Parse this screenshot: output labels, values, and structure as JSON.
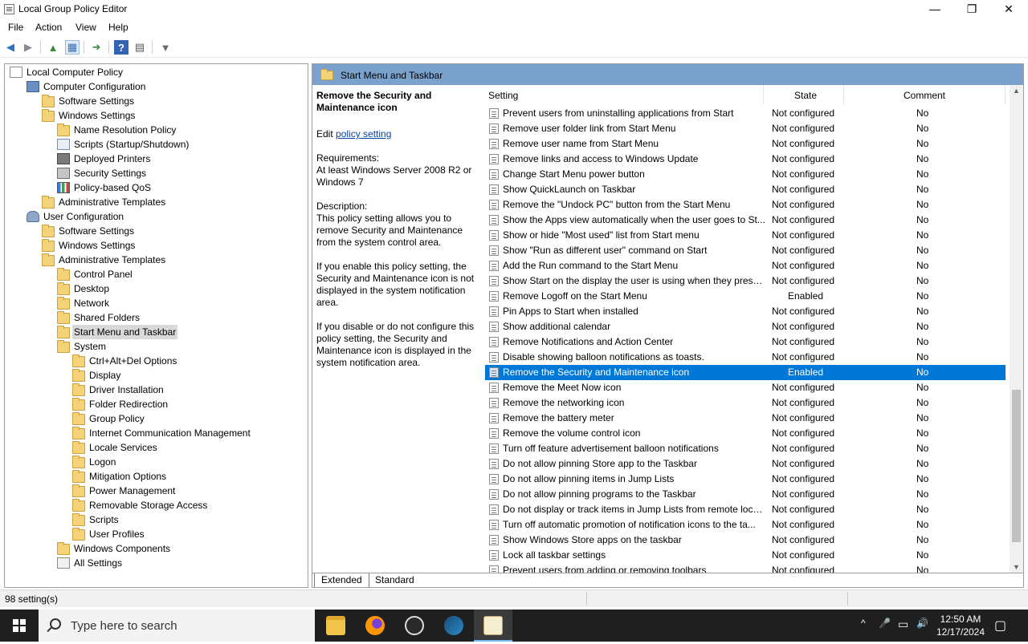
{
  "window": {
    "title": "Local Group Policy Editor",
    "minimize": "—",
    "maximize": "❐",
    "close": "✕"
  },
  "menu": [
    "File",
    "Action",
    "View",
    "Help"
  ],
  "tree": [
    {
      "label": "Local Computer Policy",
      "icon": "policy",
      "exp": ""
    },
    {
      "label": "Computer Configuration",
      "icon": "computer",
      "exp": "v"
    },
    {
      "label": "Software Settings",
      "icon": "folder",
      "exp": ">"
    },
    {
      "label": "Windows Settings",
      "icon": "folder",
      "exp": "v"
    },
    {
      "label": "Name Resolution Policy",
      "icon": "folder",
      "exp": ">"
    },
    {
      "label": "Scripts (Startup/Shutdown)",
      "icon": "script",
      "exp": ""
    },
    {
      "label": "Deployed Printers",
      "icon": "printer",
      "exp": ">"
    },
    {
      "label": "Security Settings",
      "icon": "security",
      "exp": ">"
    },
    {
      "label": "Policy-based QoS",
      "icon": "qos",
      "exp": ">"
    },
    {
      "label": "Administrative Templates",
      "icon": "folder",
      "exp": ">"
    },
    {
      "label": "User Configuration",
      "icon": "user",
      "exp": "v"
    },
    {
      "label": "Software Settings",
      "icon": "folder",
      "exp": ">"
    },
    {
      "label": "Windows Settings",
      "icon": "folder",
      "exp": ">"
    },
    {
      "label": "Administrative Templates",
      "icon": "folder",
      "exp": "v"
    },
    {
      "label": "Control Panel",
      "icon": "folder",
      "exp": ">"
    },
    {
      "label": "Desktop",
      "icon": "folder",
      "exp": ">"
    },
    {
      "label": "Network",
      "icon": "folder",
      "exp": ">"
    },
    {
      "label": "Shared Folders",
      "icon": "folder",
      "exp": ""
    },
    {
      "label": "Start Menu and Taskbar",
      "icon": "folder",
      "exp": ">"
    },
    {
      "label": "System",
      "icon": "folder",
      "exp": "v"
    },
    {
      "label": "Ctrl+Alt+Del Options",
      "icon": "folder",
      "exp": ""
    },
    {
      "label": "Display",
      "icon": "folder",
      "exp": ""
    },
    {
      "label": "Driver Installation",
      "icon": "folder",
      "exp": ""
    },
    {
      "label": "Folder Redirection",
      "icon": "folder",
      "exp": ""
    },
    {
      "label": "Group Policy",
      "icon": "folder",
      "exp": ""
    },
    {
      "label": "Internet Communication Management",
      "icon": "folder",
      "exp": ">"
    },
    {
      "label": "Locale Services",
      "icon": "folder",
      "exp": ""
    },
    {
      "label": "Logon",
      "icon": "folder",
      "exp": ""
    },
    {
      "label": "Mitigation Options",
      "icon": "folder",
      "exp": ""
    },
    {
      "label": "Power Management",
      "icon": "folder",
      "exp": ""
    },
    {
      "label": "Removable Storage Access",
      "icon": "folder",
      "exp": ""
    },
    {
      "label": "Scripts",
      "icon": "folder",
      "exp": ""
    },
    {
      "label": "User Profiles",
      "icon": "folder",
      "exp": ""
    },
    {
      "label": "Windows Components",
      "icon": "folder",
      "exp": ">"
    },
    {
      "label": "All Settings",
      "icon": "allset",
      "exp": ""
    }
  ],
  "pane_header": "Start Menu and Taskbar",
  "description": {
    "title": "Remove the Security and Maintenance icon",
    "edit_prefix": "Edit ",
    "edit_link": "policy setting ",
    "requirements_label": "Requirements:",
    "requirements": "At least Windows Server 2008 R2 or Windows 7",
    "description_label": "Description:",
    "p1": "This policy setting allows you to remove Security and Maintenance from the system control area.",
    "p2": "If you enable this policy setting, the Security and Maintenance icon is not displayed in the system notification area.",
    "p3": "If you disable or do not configure this policy setting, the Security and Maintenance icon is displayed in the system notification area."
  },
  "columns": {
    "setting": "Setting",
    "state": "State",
    "comment": "Comment"
  },
  "rows": [
    {
      "setting": "Prevent users from uninstalling applications from Start",
      "state": "Not configured",
      "comment": "No"
    },
    {
      "setting": "Remove user folder link from Start Menu",
      "state": "Not configured",
      "comment": "No"
    },
    {
      "setting": "Remove user name from Start Menu",
      "state": "Not configured",
      "comment": "No"
    },
    {
      "setting": "Remove links and access to Windows Update",
      "state": "Not configured",
      "comment": "No"
    },
    {
      "setting": "Change Start Menu power button",
      "state": "Not configured",
      "comment": "No"
    },
    {
      "setting": "Show QuickLaunch on Taskbar",
      "state": "Not configured",
      "comment": "No"
    },
    {
      "setting": "Remove the \"Undock PC\" button from the Start Menu",
      "state": "Not configured",
      "comment": "No"
    },
    {
      "setting": "Show the Apps view automatically when the user goes to St...",
      "state": "Not configured",
      "comment": "No"
    },
    {
      "setting": "Show or hide \"Most used\" list from Start menu",
      "state": "Not configured",
      "comment": "No"
    },
    {
      "setting": "Show \"Run as different user\" command on Start",
      "state": "Not configured",
      "comment": "No"
    },
    {
      "setting": "Add the Run command to the Start Menu",
      "state": "Not configured",
      "comment": "No"
    },
    {
      "setting": "Show Start on the display the user is using when they press t...",
      "state": "Not configured",
      "comment": "No"
    },
    {
      "setting": "Remove Logoff on the Start Menu",
      "state": "Enabled",
      "comment": "No"
    },
    {
      "setting": "Pin Apps to Start when installed",
      "state": "Not configured",
      "comment": "No"
    },
    {
      "setting": "Show additional calendar",
      "state": "Not configured",
      "comment": "No"
    },
    {
      "setting": "Remove Notifications and Action Center",
      "state": "Not configured",
      "comment": "No"
    },
    {
      "setting": "Disable showing balloon notifications as toasts.",
      "state": "Not configured",
      "comment": "No"
    },
    {
      "setting": "Remove the Security and Maintenance icon",
      "state": "Enabled",
      "comment": "No",
      "selected": true
    },
    {
      "setting": "Remove the Meet Now icon",
      "state": "Not configured",
      "comment": "No"
    },
    {
      "setting": "Remove the networking icon",
      "state": "Not configured",
      "comment": "No"
    },
    {
      "setting": "Remove the battery meter",
      "state": "Not configured",
      "comment": "No"
    },
    {
      "setting": "Remove the volume control icon",
      "state": "Not configured",
      "comment": "No"
    },
    {
      "setting": "Turn off feature advertisement balloon notifications",
      "state": "Not configured",
      "comment": "No"
    },
    {
      "setting": "Do not allow pinning Store app to the Taskbar",
      "state": "Not configured",
      "comment": "No"
    },
    {
      "setting": "Do not allow pinning items in Jump Lists",
      "state": "Not configured",
      "comment": "No"
    },
    {
      "setting": "Do not allow pinning programs to the Taskbar",
      "state": "Not configured",
      "comment": "No"
    },
    {
      "setting": "Do not display or track items in Jump Lists from remote loca...",
      "state": "Not configured",
      "comment": "No"
    },
    {
      "setting": "Turn off automatic promotion of notification icons to the ta...",
      "state": "Not configured",
      "comment": "No"
    },
    {
      "setting": "Show Windows Store apps on the taskbar",
      "state": "Not configured",
      "comment": "No"
    },
    {
      "setting": "Lock all taskbar settings",
      "state": "Not configured",
      "comment": "No"
    },
    {
      "setting": "Prevent users from adding or removing toolbars",
      "state": "Not configured",
      "comment": "No"
    }
  ],
  "tabs": {
    "extended": "Extended",
    "standard": "Standard"
  },
  "status": "98 setting(s)",
  "taskbar": {
    "search_placeholder": "Type here to search",
    "time": "12:50 AM",
    "date": "12/17/2024",
    "tray_chevron": "^",
    "tray_mic": "🎤",
    "tray_network": "▭",
    "tray_volume": "🔊",
    "tray_notify": "▢"
  },
  "toolbar_icons": {
    "back": "◀",
    "forward": "▶",
    "up": "▲",
    "show_hide": "▦",
    "export": "➜",
    "help": "?",
    "properties": "▤",
    "filter": "▼"
  },
  "colors": {
    "accent": "#0078d7",
    "header": "#7aa2cc"
  }
}
